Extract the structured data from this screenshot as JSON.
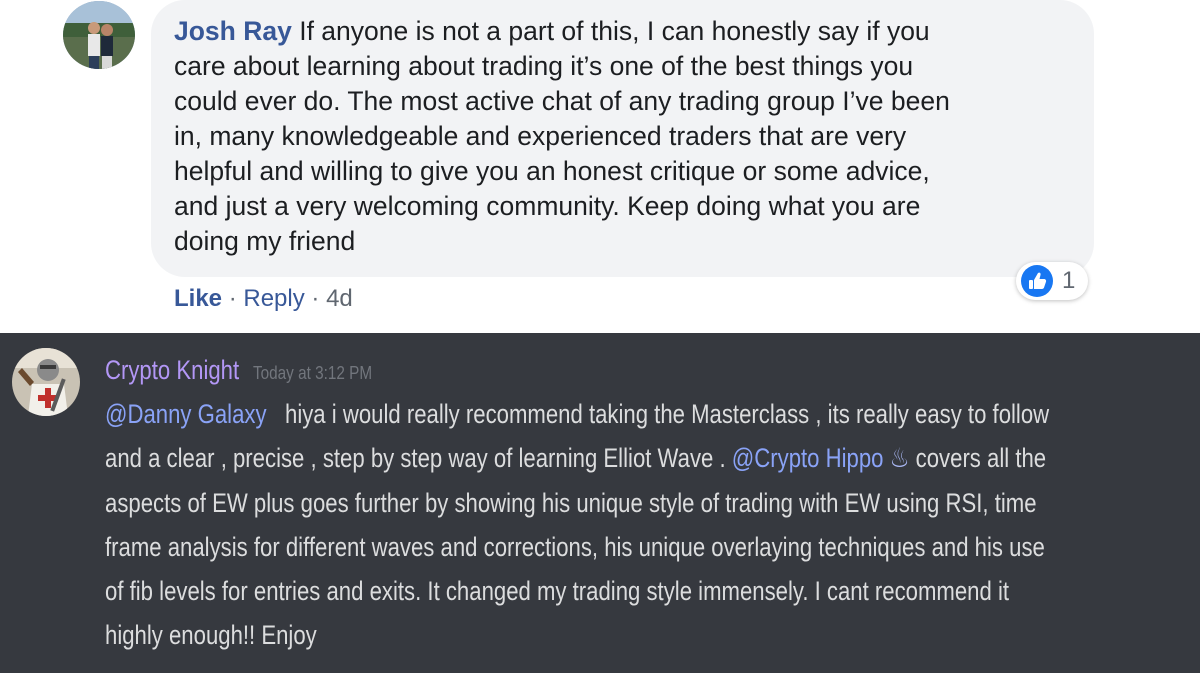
{
  "facebook_comment": {
    "author": "Josh Ray",
    "text_lines": [
      "If anyone is not a part of this, I can honestly say if you",
      "care about learning about trading it’s one of the best things you",
      "could ever do. The most active chat of any trading group I’ve been",
      "in, many knowledgeable and experienced traders that are very",
      "helpful and willing to give you an honest critique or some advice,",
      "and just a very welcoming community. Keep doing what you are",
      "doing my friend"
    ],
    "actions": {
      "like": "Like",
      "reply": "Reply",
      "separator": "·",
      "age": "4d"
    },
    "reaction": {
      "icon": "thumbs-up-icon",
      "count": "1",
      "color": "#1877f2"
    }
  },
  "discord_message": {
    "author": "Crypto Knight",
    "timestamp": "Today at 3:12 PM",
    "mention_1": "@Danny Galaxy",
    "line_1": "hiya i would really recommend taking the Masterclass , its really easy to follow",
    "line_2a": "and a clear , precise , step by step way of learning Elliot Wave .",
    "mention_2": "@Crypto Hippo",
    "mention_2_icon": "flame-icon",
    "line_2b": "covers all the",
    "line_3": "aspects of EW plus goes further by showing his unique style of trading with EW using RSI, time",
    "line_4": "frame analysis for different waves and corrections, his unique overlaying techniques and his use",
    "line_5": "of fib levels for entries and exits. It changed my trading style immensely. I cant recommend it",
    "line_6": "highly enough!! Enjoy",
    "colors": {
      "background": "#36393f",
      "author": "#b397f6",
      "mention": "#8aa3f7",
      "text": "#dcddde"
    }
  }
}
